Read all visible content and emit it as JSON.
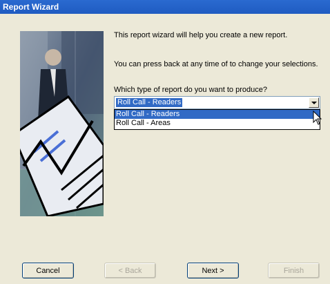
{
  "window": {
    "title": "Report Wizard"
  },
  "intro": {
    "line1": "This report wizard will help you create a new report.",
    "line2": "You can press back at any time of to change your selections.",
    "question": "Which type of report do you want to produce?"
  },
  "report_type": {
    "selected": "Roll Call - Readers",
    "options": [
      "Roll Call - Readers",
      "Roll Call - Areas"
    ]
  },
  "buttons": {
    "cancel": "Cancel",
    "back": "< Back",
    "next": "Next >",
    "finish": "Finish"
  },
  "colors": {
    "titlebar": "#1f5bc1",
    "selection": "#316ac5",
    "dialog_bg": "#ece9d8"
  }
}
